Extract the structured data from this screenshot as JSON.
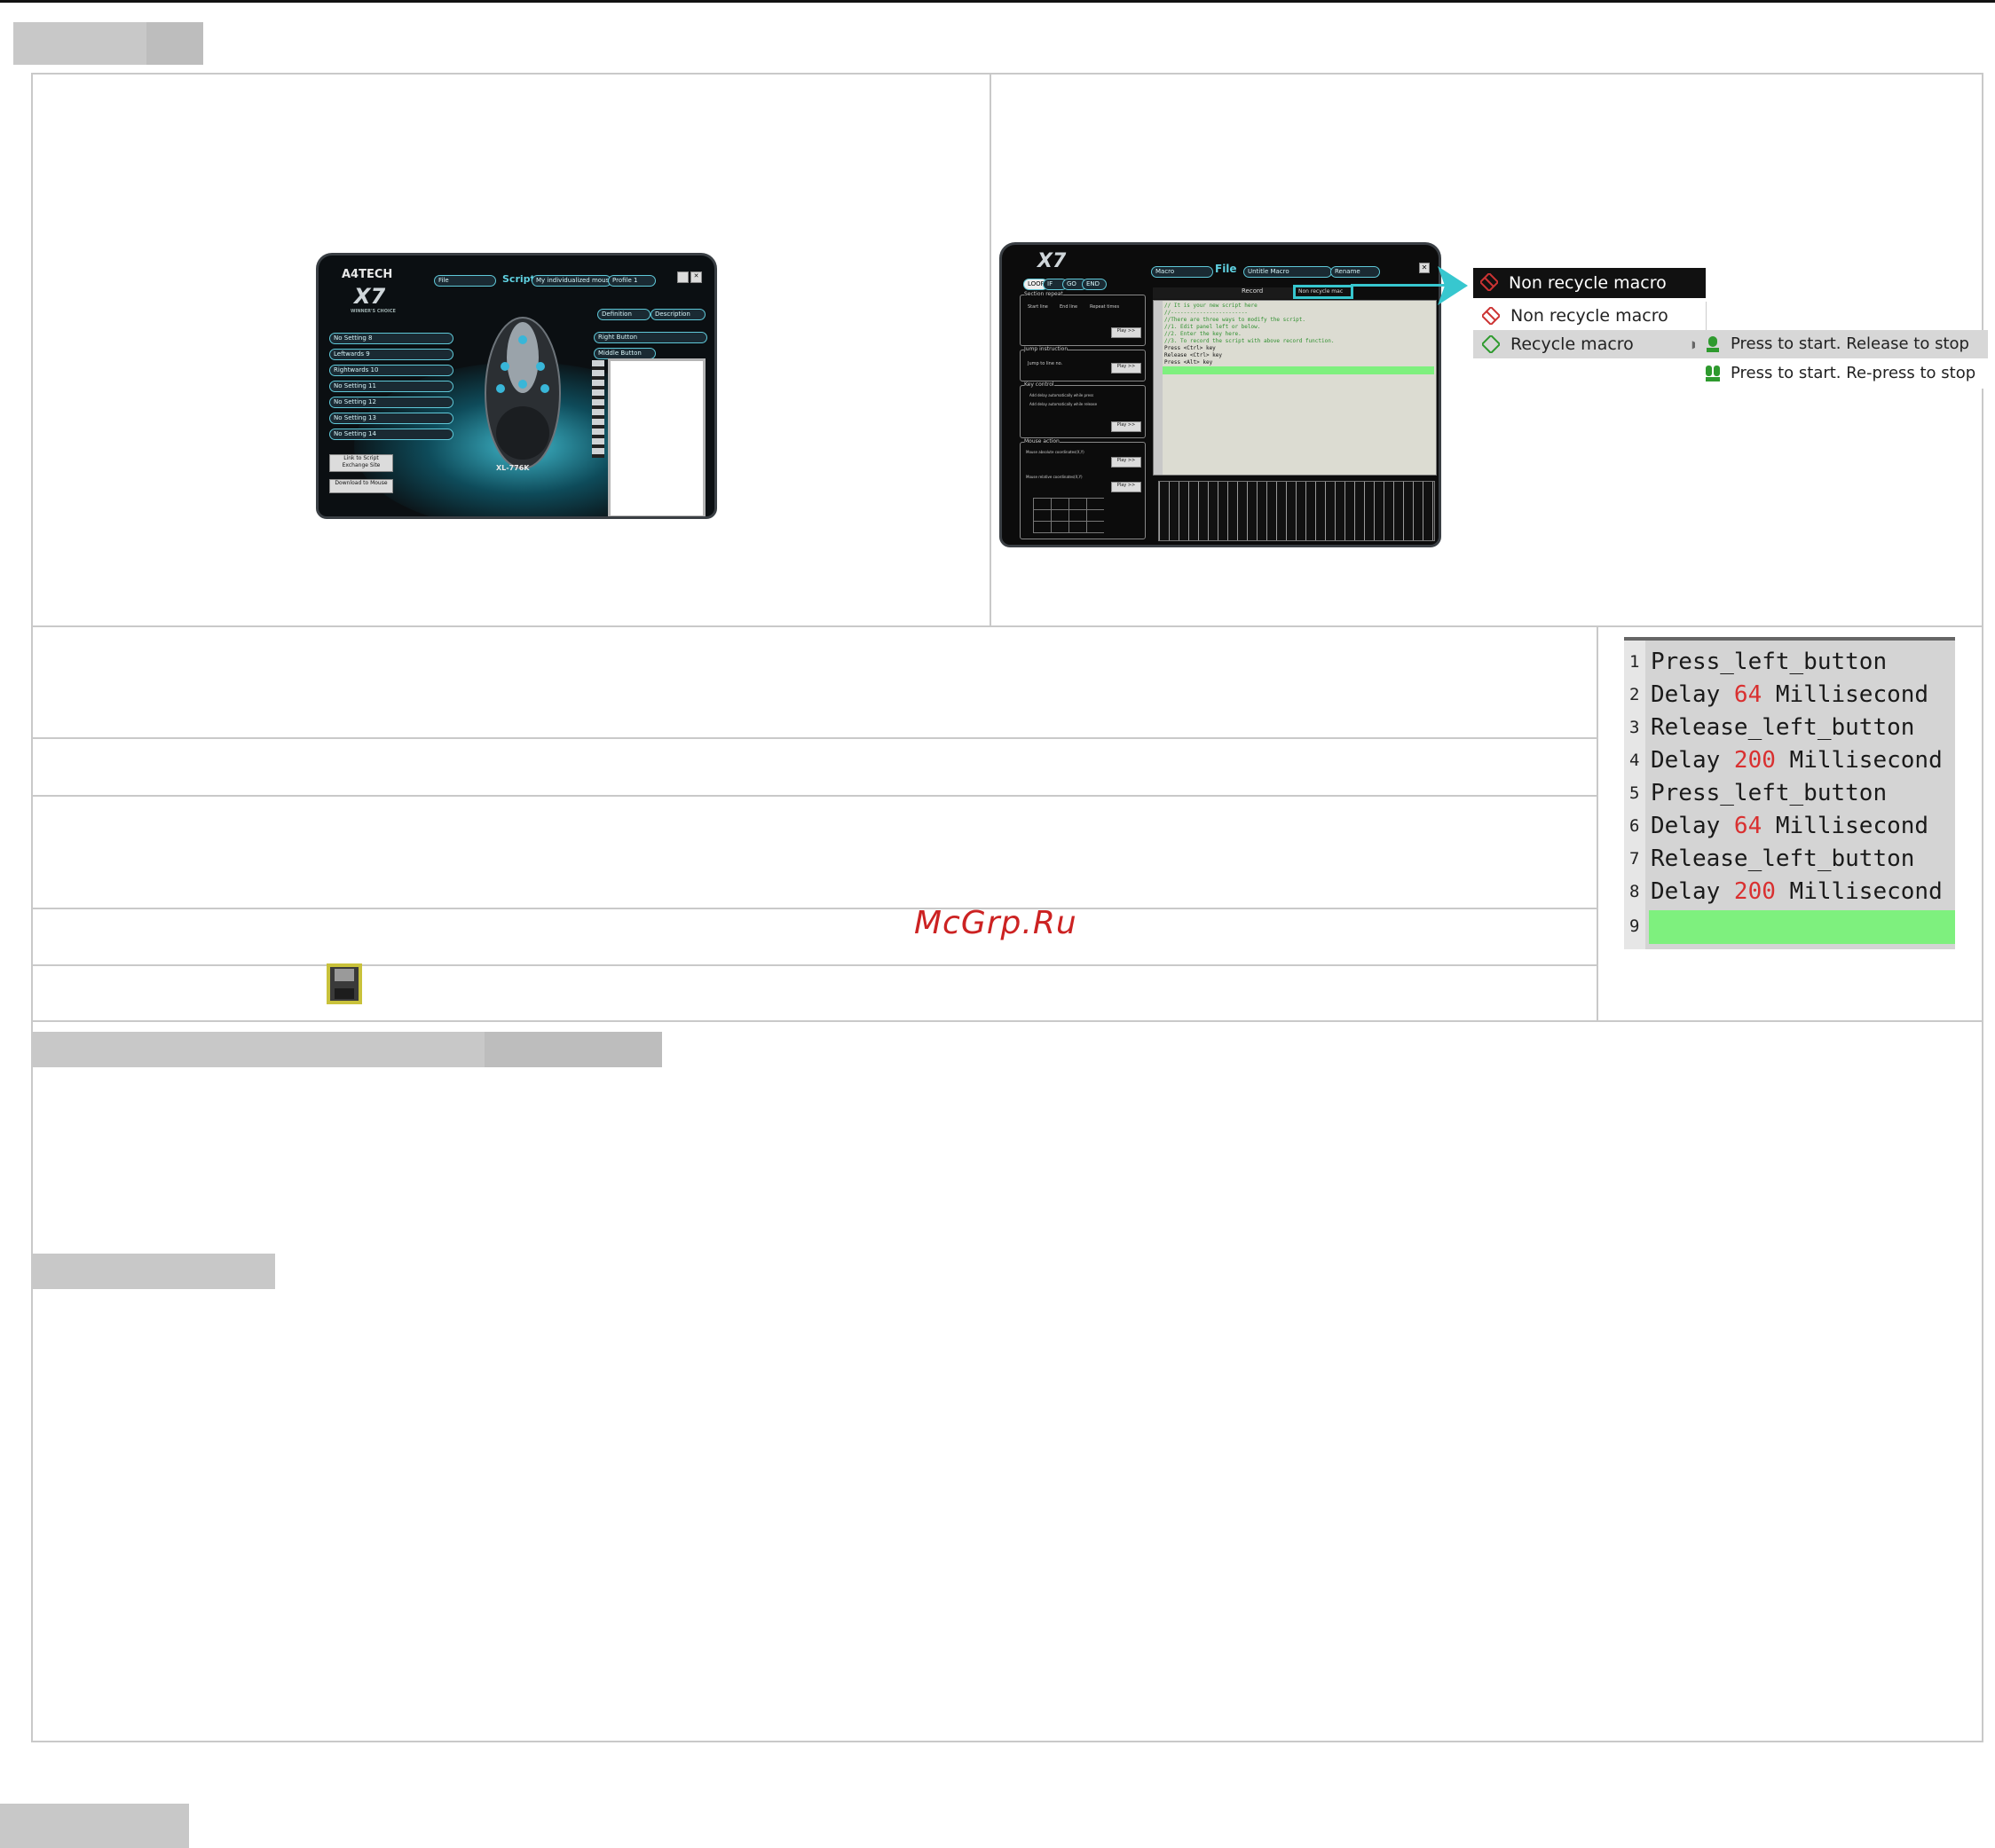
{
  "watermark": "McGrp.Ru",
  "left_window": {
    "brand": "A4TECH",
    "model_logo": "X7",
    "tagline": "WINNER'S CHOICE",
    "file_label": "File",
    "script_label": "Script",
    "profile_name": "My individualized mouse",
    "profile_slot": "Profile 1",
    "definition_tab": "Definition",
    "description_tab": "Description",
    "right_button": "Right Button",
    "middle_button": "Middle Button",
    "model_name": "XL-776K",
    "button_rows": [
      {
        "label": "No Setting",
        "num": "8"
      },
      {
        "label": "Leftwards",
        "num": "9"
      },
      {
        "label": "Rightwards",
        "num": "10"
      },
      {
        "label": "No Setting",
        "num": "11"
      },
      {
        "label": "No Setting",
        "num": "12"
      },
      {
        "label": "No Setting",
        "num": "13"
      },
      {
        "label": "No Setting",
        "num": "14"
      }
    ],
    "link_button": "Link to Script Exchange Site",
    "download_button": "Download to Mouse"
  },
  "right_window": {
    "model_logo": "X7",
    "tabs": [
      "LOOP",
      "IF",
      "GO",
      "END"
    ],
    "macro_label": "Macro",
    "file_label": "File",
    "script_name": "Untitle Macro",
    "rename_label": "Rename",
    "record_label": "Record",
    "nonrecycle_combo": "Non recycle mac",
    "section_repeat": "Section repeat",
    "start_line": "Start line",
    "end_line": "End line",
    "repeat_times": "Repeat times",
    "jump_instruction": "Jump instruction",
    "jump_to_line": "Jump to line no.",
    "key_control": "Key control",
    "auto_press": "Add delay automatically while press",
    "auto_release": "Add delay automatically while release",
    "mouse_action": "Mouse action",
    "mouse_abs": "Mouse absolute coordinates(X,Y)",
    "mouse_rel": "Mouse relative coordinates(X,Y)",
    "play_label": "Play >>",
    "editor_lines": [
      "//  It is your new script here",
      "//------------------------",
      "//There are three ways to modify the script.",
      "//1. Edit panel left or below.",
      "//2. Enter the key here.",
      "//3. To record the script with above record function.",
      "Press <Ctrl> key",
      "Release <Ctrl> key",
      "Press <Alt> key",
      ""
    ]
  },
  "dropdown": {
    "header": "Non recycle macro",
    "items": [
      "Non recycle macro",
      "Recycle macro"
    ],
    "submenu": [
      "Press to start. Release to stop",
      "Press to start. Re-press to stop"
    ]
  },
  "code": {
    "lines": [
      {
        "n": "1",
        "pre": "Press_left_button",
        "num": "",
        "post": ""
      },
      {
        "n": "2",
        "pre": "Delay ",
        "num": "64",
        "post": " Millisecond"
      },
      {
        "n": "3",
        "pre": "Release_left_button",
        "num": "",
        "post": ""
      },
      {
        "n": "4",
        "pre": "Delay ",
        "num": "200",
        "post": " Millisecond"
      },
      {
        "n": "5",
        "pre": "Press_left_button",
        "num": "",
        "post": ""
      },
      {
        "n": "6",
        "pre": "Delay ",
        "num": "64",
        "post": " Millisecond"
      },
      {
        "n": "7",
        "pre": "Release_left_button",
        "num": "",
        "post": ""
      },
      {
        "n": "8",
        "pre": "Delay ",
        "num": "200",
        "post": " Millisecond"
      },
      {
        "n": "9",
        "pre": "",
        "num": "",
        "post": ""
      }
    ]
  },
  "colors": {
    "accent_cyan": "#37c7cf",
    "code_highlight": "#7ef07e",
    "dropdown_header": "#111111"
  },
  "icons": [
    "save-disk-icon",
    "non-recycle-macro-icon",
    "recycle-macro-icon",
    "press-release-icon",
    "press-repress-icon"
  ]
}
